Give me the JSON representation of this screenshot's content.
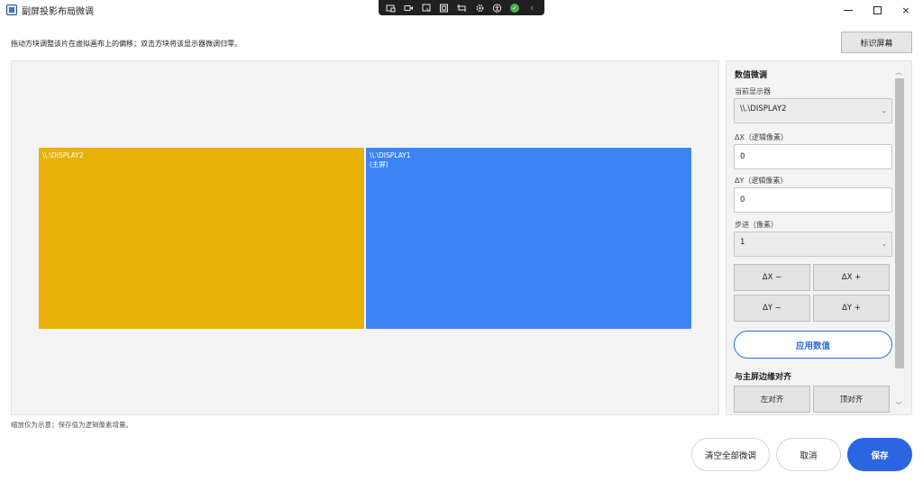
{
  "window": {
    "title": "副屏投影布局微调",
    "minimize": "minimize",
    "maximize": "maximize",
    "close": "×"
  },
  "capture_toolbar": {
    "icons": [
      "screenshot-icon",
      "record-icon",
      "pointer-icon",
      "region-icon",
      "crop-pin-icon",
      "settings-icon",
      "accessibility-icon",
      "check-icon",
      "chevron-left-icon"
    ],
    "check_symbol": "✓",
    "chevron_symbol": "‹"
  },
  "instruction": "拖动方块调整该片在虚拟画布上的偏移；双击方块将该显示器微调归零。",
  "identify_button": "标识屏幕",
  "canvas": {
    "displays": [
      {
        "name": "\\\\.\\DISPLAY2",
        "tag": "",
        "color": "#e8b208"
      },
      {
        "name": "\\\\.\\DISPLAY1",
        "tag": "(主屏)",
        "color": "#3c84f5"
      }
    ]
  },
  "panel": {
    "title": "数值微调",
    "current_display_label": "当前显示器",
    "current_display_value": "\\\\.\\DISPLAY2",
    "dx_label": "ΔX（逻辑像素）",
    "dx_value": "0",
    "dy_label": "ΔY（逻辑像素）",
    "dy_value": "0",
    "step_label": "步进（像素）",
    "step_value": "1",
    "dx_minus": "ΔX −",
    "dx_plus": "ΔX +",
    "dy_minus": "ΔY −",
    "dy_plus": "ΔY +",
    "apply": "应用数值",
    "align_title": "与主屏边缘对齐",
    "align_left": "左对齐",
    "align_top": "顶对齐",
    "chevron": "⌄",
    "scroll_up": "︿",
    "scroll_down": "﹀"
  },
  "footnote": "缩放仅为示意；保存值为逻辑像素增量。",
  "footer": {
    "clear_all": "清空全部微调",
    "cancel": "取消",
    "save": "保存"
  },
  "colors": {
    "accent": "#2b66e0",
    "display2": "#e8b208",
    "display1": "#3c84f5"
  }
}
